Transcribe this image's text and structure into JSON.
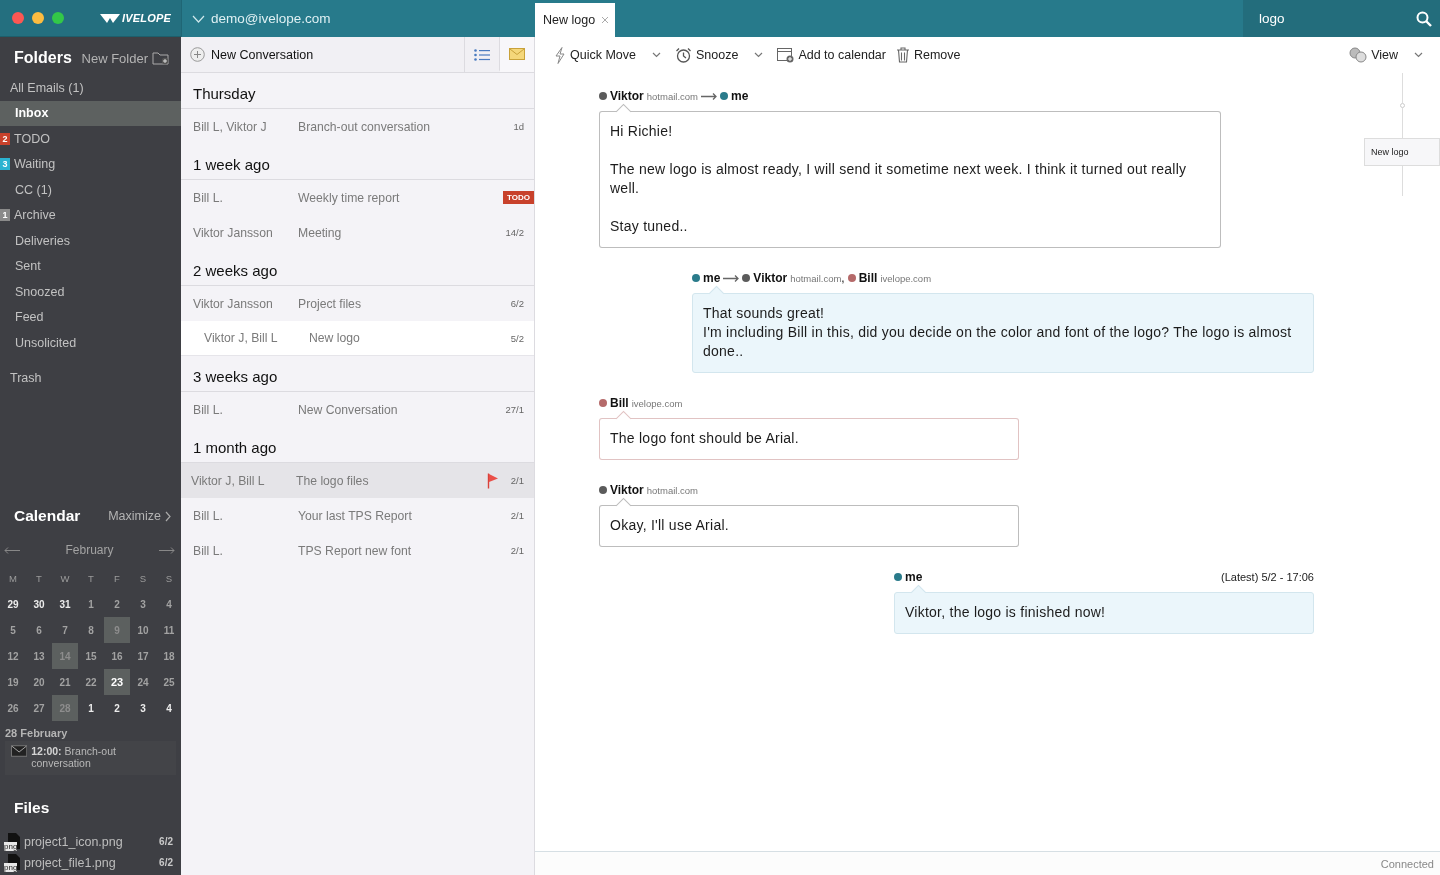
{
  "app": {
    "logo": "IVELOPE"
  },
  "account": {
    "email": "demo@ivelope.com"
  },
  "tabs": [
    {
      "label": "New logo",
      "selected": true
    }
  ],
  "search": {
    "value": "logo"
  },
  "folders": {
    "title": "Folders",
    "new_folder": "New Folder",
    "items": [
      {
        "label": "All Emails (1)",
        "selected": false,
        "children": [
          {
            "label": "Inbox",
            "selected": true
          },
          {
            "label": "TODO",
            "badge": "2",
            "color": "#c8412b",
            "selected": false
          },
          {
            "label": "Waiting",
            "badge": "3",
            "color": "#2bb3d1",
            "selected": false
          },
          {
            "label": "CC (1)",
            "selected": false
          },
          {
            "label": "Archive",
            "badge": "1",
            "color": "#8a8a8a",
            "selected": false
          },
          {
            "label": "Deliveries",
            "selected": false
          },
          {
            "label": "Sent",
            "selected": false
          },
          {
            "label": "Snoozed",
            "selected": false
          },
          {
            "label": "Feed",
            "selected": false
          },
          {
            "label": "Unsolicited",
            "selected": false
          }
        ]
      },
      {
        "label": "Trash",
        "selected": false
      }
    ]
  },
  "calendar": {
    "title": "Calendar",
    "maximize": "Maximize",
    "month": "February",
    "weekdays": [
      "M",
      "T",
      "W",
      "T",
      "F",
      "S",
      "S"
    ],
    "weeks": [
      [
        {
          "d": "29",
          "outside": true
        },
        {
          "d": "30",
          "outside": true
        },
        {
          "d": "31",
          "outside": true
        },
        {
          "d": "1",
          "outside": false
        },
        {
          "d": "2",
          "outside": false
        },
        {
          "d": "3",
          "outside": false
        },
        {
          "d": "4",
          "outside": false
        }
      ],
      [
        {
          "d": "5",
          "outside": false
        },
        {
          "d": "6",
          "outside": false
        },
        {
          "d": "7",
          "outside": false
        },
        {
          "d": "8",
          "outside": false
        },
        {
          "d": "9",
          "outside": false,
          "event": true
        },
        {
          "d": "10",
          "outside": false
        },
        {
          "d": "11",
          "outside": false
        }
      ],
      [
        {
          "d": "12",
          "outside": false
        },
        {
          "d": "13",
          "outside": false
        },
        {
          "d": "14",
          "outside": false,
          "event": true
        },
        {
          "d": "15",
          "outside": false
        },
        {
          "d": "16",
          "outside": false
        },
        {
          "d": "17",
          "outside": false
        },
        {
          "d": "18",
          "outside": false
        }
      ],
      [
        {
          "d": "19",
          "outside": false
        },
        {
          "d": "20",
          "outside": false
        },
        {
          "d": "21",
          "outside": false
        },
        {
          "d": "22",
          "outside": false
        },
        {
          "d": "23",
          "outside": false,
          "today": true
        },
        {
          "d": "24",
          "outside": false
        },
        {
          "d": "25",
          "outside": false
        }
      ],
      [
        {
          "d": "26",
          "outside": false
        },
        {
          "d": "27",
          "outside": false
        },
        {
          "d": "28",
          "outside": false,
          "event": true
        },
        {
          "d": "1",
          "outside": true
        },
        {
          "d": "2",
          "outside": true
        },
        {
          "d": "3",
          "outside": true
        },
        {
          "d": "4",
          "outside": true
        }
      ]
    ],
    "agenda": {
      "date": "28 February",
      "events": [
        {
          "text": "**12:00:** Branch-out conversation"
        }
      ]
    }
  },
  "files": {
    "title": "Files",
    "items": [
      {
        "ext": "png",
        "name": "project1_icon.png",
        "date": "6/2"
      },
      {
        "ext": "png",
        "name": "project_file1.png",
        "date": "6/2"
      }
    ]
  },
  "list_toolbar": {
    "new": "New Conversation",
    "views": [
      {
        "kind": "list",
        "selected": false
      },
      {
        "kind": "mail",
        "selected": true
      }
    ]
  },
  "groups": [
    {
      "heading": "Thursday",
      "rows": [
        {
          "from": "Bill L, Viktor J",
          "subject": "Branch-out conversation",
          "date": "1d",
          "selected": false,
          "highlighted": false,
          "nested": false,
          "flagged": false
        }
      ]
    },
    {
      "heading": "1 week ago",
      "rows": [
        {
          "from": "Bill L.",
          "subject": "Weekly time report",
          "tag": "TODO",
          "selected": false,
          "highlighted": false,
          "nested": false,
          "flagged": false
        },
        {
          "from": "Viktor Jansson",
          "subject": "Meeting",
          "date": "14/2",
          "selected": false,
          "highlighted": false,
          "nested": false,
          "flagged": false
        }
      ]
    },
    {
      "heading": "2 weeks ago",
      "rows": [
        {
          "from": "Viktor Jansson",
          "subject": "Project files",
          "date": "6/2",
          "selected": false,
          "highlighted": false,
          "nested": false,
          "flagged": false
        },
        {
          "from": "Viktor J, Bill L",
          "subject": "New logo",
          "date": "5/2",
          "selected": true,
          "highlighted": false,
          "nested": true,
          "flagged": false
        }
      ]
    },
    {
      "heading": "3 weeks ago",
      "rows": [
        {
          "from": "Bill L.",
          "subject": "New Conversation",
          "date": "27/1",
          "selected": false,
          "highlighted": false,
          "nested": false,
          "flagged": false
        }
      ]
    },
    {
      "heading": "1 month ago",
      "rows": [
        {
          "from": "Viktor J, Bill L",
          "subject": "The logo files",
          "date": "2/1",
          "selected": false,
          "highlighted": true,
          "nested": false,
          "flagged": true
        },
        {
          "from": "Bill L.",
          "subject": "Your last TPS Report",
          "date": "2/1",
          "selected": false,
          "highlighted": false,
          "nested": false,
          "flagged": false
        },
        {
          "from": "Bill L.",
          "subject": "TPS Report new font",
          "date": "2/1",
          "selected": false,
          "highlighted": false,
          "nested": false,
          "flagged": false
        }
      ]
    }
  ],
  "actions": [
    {
      "kind": "move",
      "label": "Quick Move",
      "dropdown": true
    },
    {
      "kind": "snooze",
      "label": "Snooze",
      "dropdown": true
    },
    {
      "kind": "calendar",
      "label": "Add to calendar",
      "dropdown": false
    },
    {
      "kind": "remove",
      "label": "Remove",
      "dropdown": false
    },
    {
      "kind": "view",
      "label": "View",
      "dropdown": true
    }
  ],
  "messages": [
    {
      "outgoing": false,
      "from": [
        {
          "name": "Viktor",
          "domain": "hotmail.com",
          "color": "#5b5b5b"
        }
      ],
      "to": [
        {
          "name": "me",
          "color": "#2a7b8b"
        }
      ],
      "paragraphs": [
        [
          "Hi Richie!"
        ],
        [
          "The new logo is almost ready, I will send it sometime next week. I think it turned out really well."
        ],
        [
          "Stay tuned.."
        ]
      ]
    },
    {
      "outgoing": true,
      "from": [
        {
          "name": "me",
          "color": "#2a7b8b"
        }
      ],
      "to": [
        {
          "name": "Viktor",
          "domain": "hotmail.com",
          "separator": ",",
          "color": "#5b5b5b"
        },
        {
          "name": "Bill",
          "domain": "ivelope.com",
          "color": "#b56a6a"
        }
      ],
      "paragraphs": [
        [
          "That sounds great!",
          "I'm including Bill in this, did you decide on the color and font of the logo? The logo is almost done.."
        ]
      ]
    },
    {
      "outgoing": false,
      "from": [
        {
          "name": "Bill",
          "domain": "ivelope.com",
          "color": "#b56a6a"
        }
      ],
      "paragraphs": [
        [
          "The logo font should be Arial."
        ]
      ]
    },
    {
      "outgoing": false,
      "from": [
        {
          "name": "Viktor",
          "domain": "hotmail.com",
          "color": "#5b5b5b"
        }
      ],
      "paragraphs": [
        [
          "Okay, I'll use Arial."
        ]
      ]
    },
    {
      "outgoing": true,
      "from": [
        {
          "name": "me",
          "color": "#2a7b8b"
        }
      ],
      "meta": "(Latest) 5/2 - 17:06",
      "paragraphs": [
        [
          "Viktor, the logo is finished now!"
        ]
      ]
    }
  ],
  "timeline": {
    "label": "New logo"
  },
  "status_bar": {
    "text": "Connected"
  }
}
